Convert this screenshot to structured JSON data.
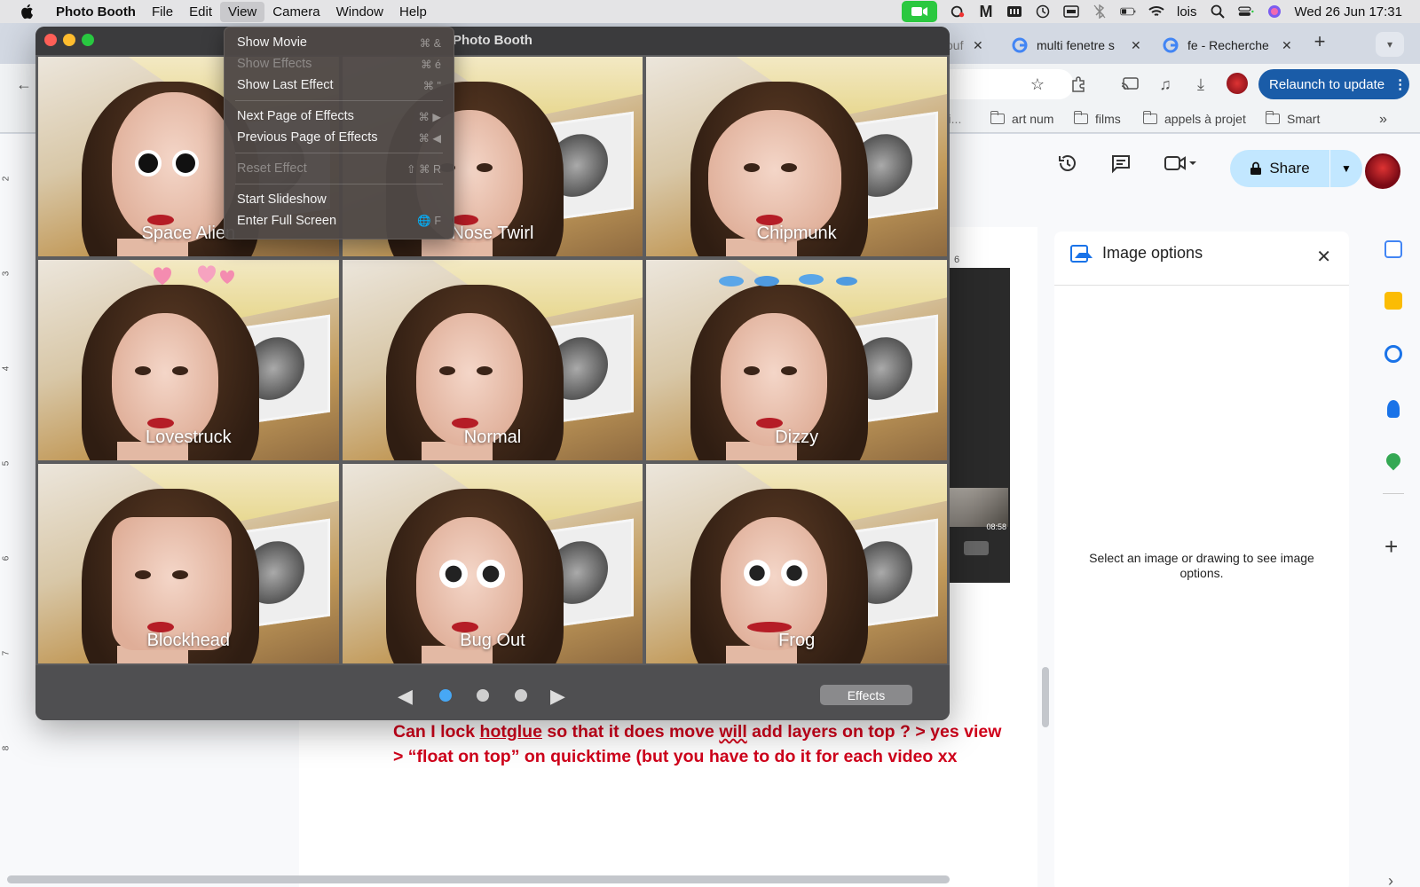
{
  "menubar": {
    "app_name": "Photo Booth",
    "items": [
      "File",
      "Edit",
      "View",
      "Camera",
      "Window",
      "Help"
    ],
    "user": "lois",
    "clock": "Wed 26 Jun  17:31"
  },
  "chrome": {
    "tabs": [
      {
        "title": "ouf"
      },
      {
        "title": "multi fenetre s"
      },
      {
        "title": "fe - Recherche"
      }
    ],
    "relaunch_label": "Relaunch to update",
    "bookmarks": [
      "rti...",
      "art num",
      "films",
      "appels à projet",
      "Smart"
    ]
  },
  "docs": {
    "share_label": "Share",
    "ruler_numbers": [
      "2",
      "3",
      "4",
      "5",
      "6",
      "7",
      "8"
    ],
    "ruler_h_fragment": "6",
    "comment": {
      "part1": "Can I lock ",
      "word_hotglue": "hotglue",
      "part2": " so that it does move ",
      "word_will": "will",
      "part3": " add layers on top ? > yes view > “float on top” on quicktime (but you have to do it for each video xx"
    },
    "partial_video_time": "08:58",
    "image_panel": {
      "title": "Image options",
      "message": "Select an image or drawing to see image options."
    }
  },
  "photobooth": {
    "window_title": "Photo Booth",
    "effects": [
      {
        "name": "Space Alien",
        "cls": "space-alien"
      },
      {
        "name": "Nose Twirl",
        "cls": "nose-twirl"
      },
      {
        "name": "Chipmunk",
        "cls": "chipmunk"
      },
      {
        "name": "Lovestruck",
        "cls": "lovestruck"
      },
      {
        "name": "Normal",
        "cls": "normal"
      },
      {
        "name": "Dizzy",
        "cls": "dizzy"
      },
      {
        "name": "Blockhead",
        "cls": "blockhead"
      },
      {
        "name": "Bug Out",
        "cls": "bug-out"
      },
      {
        "name": "Frog",
        "cls": "frog"
      }
    ],
    "page_dots": 3,
    "active_page_index": 0,
    "effects_button": "Effects"
  },
  "view_menu": {
    "groups": [
      [
        {
          "label": "Show Movie",
          "shortcut": "⌘ &",
          "enabled": true
        },
        {
          "label": "Show Effects",
          "shortcut": "⌘ é",
          "enabled": false
        },
        {
          "label": "Show Last Effect",
          "shortcut": "⌘ \"",
          "enabled": true
        }
      ],
      [
        {
          "label": "Next Page of Effects",
          "shortcut": "⌘ ▶",
          "enabled": true
        },
        {
          "label": "Previous Page of Effects",
          "shortcut": "⌘ ◀",
          "enabled": true
        }
      ],
      [
        {
          "label": "Reset Effect",
          "shortcut": "⇧ ⌘ R",
          "enabled": false
        }
      ],
      [
        {
          "label": "Start Slideshow",
          "shortcut": "",
          "enabled": true
        },
        {
          "label": "Enter Full Screen",
          "shortcut": "🌐 F",
          "enabled": true
        }
      ]
    ]
  },
  "colors": {
    "accent_blue": "#47a8f5",
    "facetime_green": "#2bc840",
    "comment_red": "#d0021b",
    "share_bg": "#c2e7ff",
    "relaunch_bg": "#1a5ca8"
  }
}
